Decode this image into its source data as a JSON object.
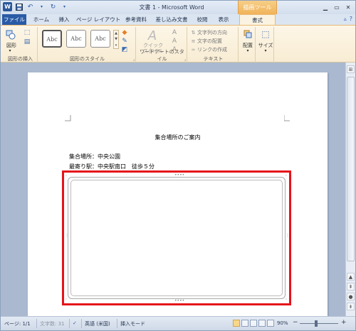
{
  "window": {
    "title": "文書 1 - Microsoft Word",
    "context_tool": "描画ツール"
  },
  "tabs": [
    {
      "label": "ファイル",
      "name": "file"
    },
    {
      "label": "ホーム",
      "name": "home"
    },
    {
      "label": "挿入",
      "name": "insert"
    },
    {
      "label": "ページ レイアウト",
      "name": "page-layout"
    },
    {
      "label": "参考資料",
      "name": "references"
    },
    {
      "label": "差し込み文書",
      "name": "mailings"
    },
    {
      "label": "校閲",
      "name": "review"
    },
    {
      "label": "表示",
      "name": "view"
    },
    {
      "label": "書式",
      "name": "format",
      "active": true
    }
  ],
  "ribbon": {
    "insert_shapes_label": "図形の挿入",
    "shape_btn": "図形",
    "shape_styles_label": "図形のスタイル",
    "style_sample": "Abc",
    "wordart_label": "ワードアートのスタイル",
    "quick_style": "クイック\nスタイル",
    "text_label": "テキスト",
    "text_direction": "文字列の方向",
    "text_align": "文字の配置",
    "create_link": "リンクの作成",
    "arrange": "配置",
    "size": "サイズ"
  },
  "document": {
    "title": "集合場所のご案内",
    "line1": "集合場所：中央公園",
    "line2": "最寄り駅：中央駅南口　徒歩５分"
  },
  "status": {
    "page": "ページ: 1/1",
    "word_count": "文字数: 31",
    "language": "英語 (米国)",
    "mode": "挿入モード",
    "zoom": "90%",
    "zoom_minus": "−",
    "zoom_plus": "+"
  },
  "colors": {
    "selection_highlight": "#e5141b",
    "file_tab": "#2a5ba7",
    "context_tab": "#f1b35a"
  }
}
